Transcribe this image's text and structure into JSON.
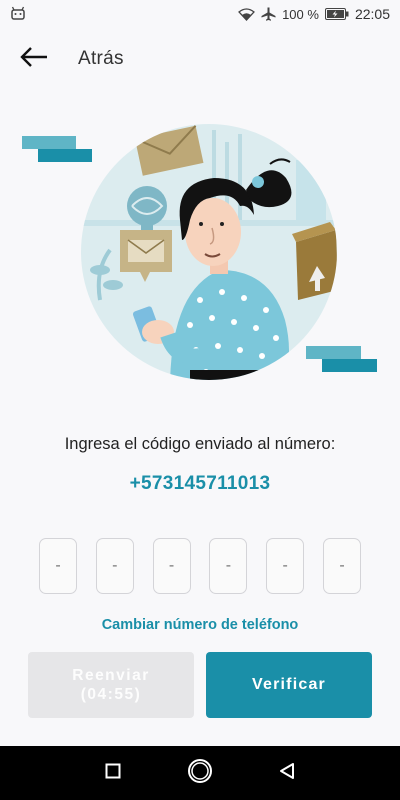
{
  "status_bar": {
    "battery_percent": "100 %",
    "time": "22:05",
    "icons": [
      "android-icon",
      "wifi-icon",
      "airplane-icon",
      "battery-charging-icon"
    ]
  },
  "header": {
    "back_icon": "arrow-left-icon",
    "title": "Atrás"
  },
  "verification": {
    "prompt": "Ingresa el código enviado al número:",
    "phone_number": "+573145711013",
    "code_placeholders": [
      "-",
      "-",
      "-",
      "-",
      "-",
      "-"
    ],
    "change_number_link": "Cambiar número de teléfono"
  },
  "actions": {
    "resend_label": "Reenviar",
    "resend_timer": "(04:55)",
    "verify_label": "Verificar"
  },
  "nav_bar": {
    "icons": [
      "square-recents-icon",
      "circle-home-icon",
      "triangle-back-icon"
    ]
  },
  "colors": {
    "accent": "#1a8fa8",
    "background": "#f8f8fa",
    "disabled_button": "#e6e6e8",
    "illustration_circle": "#dcecef"
  }
}
